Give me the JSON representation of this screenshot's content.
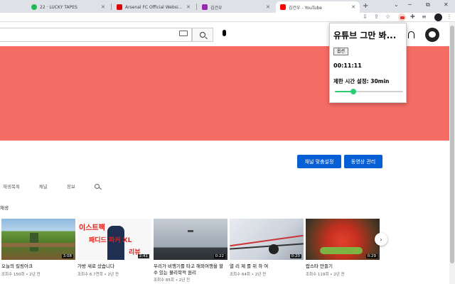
{
  "browser": {
    "tabs": [
      {
        "title": "22 · LUCKY TAPES",
        "favicon_color": "#1db954",
        "active": false
      },
      {
        "title": "Arsenal FC Official Website | Ho",
        "favicon_color": "#db0007",
        "active": false
      },
      {
        "title": "김건우",
        "favicon_color": "#9c27b0",
        "active": false
      },
      {
        "title": "김건우 - YouTube",
        "favicon_color": "#ff0000",
        "active": true
      }
    ],
    "new_tab_label": "+",
    "window_controls": {
      "chevron": "⌄",
      "minimize": "─",
      "restore": "⧉",
      "close": "✕"
    }
  },
  "toolbar": {
    "icons": [
      "download-icon",
      "share-icon",
      "star-icon",
      "extension-icon",
      "puzzle-icon",
      "media-icon",
      "sidepanel-icon",
      "profile-icon",
      "menu-icon"
    ]
  },
  "youtube": {
    "banner_color": "#f56c64",
    "buttons": {
      "customize": "채널 맞춤설정",
      "manage": "동영상 관리"
    },
    "channel_tabs": [
      "재생목록",
      "채널",
      "정보"
    ],
    "section_title": "재생",
    "videos": [
      {
        "title": "오늘의 킬링아크",
        "meta": "조회수 150회 • 2년 전",
        "duration": "3:08"
      },
      {
        "title": "가방 새로 샀습니다",
        "meta": "조회수 6.7천회 • 2년 전",
        "duration": "2:41",
        "thumb_text": {
          "line1": "이스트팩",
          "line2": "패디드 파커 XL",
          "line3": "리뷰"
        }
      },
      {
        "title": "우리가 비행기를 타고 해외여행을 할 수 있는 물리학적 원리",
        "meta": "조회수 85회 • 2년 전",
        "duration": "0:22"
      },
      {
        "title": "열 리 제 를 위 하 여",
        "meta": "조회수 64회 • 2년 전",
        "duration": "0:20"
      },
      {
        "title": "랍스타 만들기",
        "meta": "조회수 119회 • 2년 전",
        "duration": "0:29"
      }
    ],
    "next_arrow": "›"
  },
  "popup": {
    "title": "유튜브 그만 봐...",
    "button_label": "옵션",
    "elapsed": "00:11:11",
    "limit_label": "제한 시간 설정: 30min",
    "slider_fraction": 0.27,
    "accent": "#2ecc71"
  }
}
